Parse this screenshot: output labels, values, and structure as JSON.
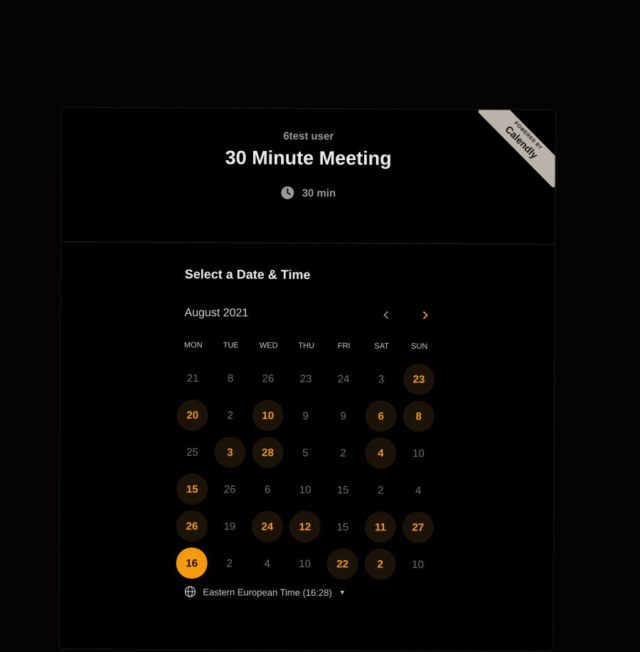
{
  "header": {
    "host_name": "6test user",
    "event_title": "30 Minute Meeting",
    "duration": "30 min"
  },
  "badge": {
    "powered_by": "POWERED BY",
    "brand": "Calendly"
  },
  "calendar": {
    "heading": "Select a Date & Time",
    "month_label": "August 2021",
    "prev_icon": "chevron-left-icon",
    "next_icon": "chevron-right-icon",
    "weekdays": [
      "MON",
      "TUE",
      "WED",
      "THU",
      "FRI",
      "SAT",
      "SUN"
    ],
    "weeks": [
      [
        {
          "day": "21",
          "state": "disabled"
        },
        {
          "day": "8",
          "state": "disabled"
        },
        {
          "day": "26",
          "state": "disabled"
        },
        {
          "day": "23",
          "state": "disabled"
        },
        {
          "day": "24",
          "state": "disabled"
        },
        {
          "day": "3",
          "state": "disabled"
        },
        {
          "day": "23",
          "state": "available"
        }
      ],
      [
        {
          "day": "20",
          "state": "available"
        },
        {
          "day": "2",
          "state": "disabled"
        },
        {
          "day": "10",
          "state": "available"
        },
        {
          "day": "9",
          "state": "disabled"
        },
        {
          "day": "9",
          "state": "disabled"
        },
        {
          "day": "6",
          "state": "available"
        },
        {
          "day": "8",
          "state": "available"
        }
      ],
      [
        {
          "day": "25",
          "state": "disabled"
        },
        {
          "day": "3",
          "state": "available"
        },
        {
          "day": "28",
          "state": "available"
        },
        {
          "day": "5",
          "state": "disabled"
        },
        {
          "day": "2",
          "state": "disabled"
        },
        {
          "day": "4",
          "state": "available"
        },
        {
          "day": "10",
          "state": "disabled"
        }
      ],
      [
        {
          "day": "15",
          "state": "available"
        },
        {
          "day": "26",
          "state": "disabled"
        },
        {
          "day": "6",
          "state": "disabled"
        },
        {
          "day": "10",
          "state": "disabled"
        },
        {
          "day": "15",
          "state": "disabled"
        },
        {
          "day": "2",
          "state": "disabled"
        },
        {
          "day": "4",
          "state": "disabled"
        }
      ],
      [
        {
          "day": "26",
          "state": "available"
        },
        {
          "day": "19",
          "state": "disabled"
        },
        {
          "day": "24",
          "state": "available"
        },
        {
          "day": "12",
          "state": "available"
        },
        {
          "day": "15",
          "state": "disabled"
        },
        {
          "day": "11",
          "state": "available"
        },
        {
          "day": "27",
          "state": "available"
        }
      ],
      [
        {
          "day": "16",
          "state": "selected"
        },
        {
          "day": "2",
          "state": "disabled"
        },
        {
          "day": "4",
          "state": "disabled"
        },
        {
          "day": "10",
          "state": "disabled"
        },
        {
          "day": "22",
          "state": "available"
        },
        {
          "day": "2",
          "state": "available"
        },
        {
          "day": "10",
          "state": "disabled"
        }
      ]
    ]
  },
  "timezone": {
    "label": "Eastern European Time (16:28)",
    "icon": "globe-icon"
  },
  "colors": {
    "accent": "#f39a1b",
    "selected": "#f59a0f",
    "available_bg": "#1b1208",
    "background": "#000000"
  }
}
